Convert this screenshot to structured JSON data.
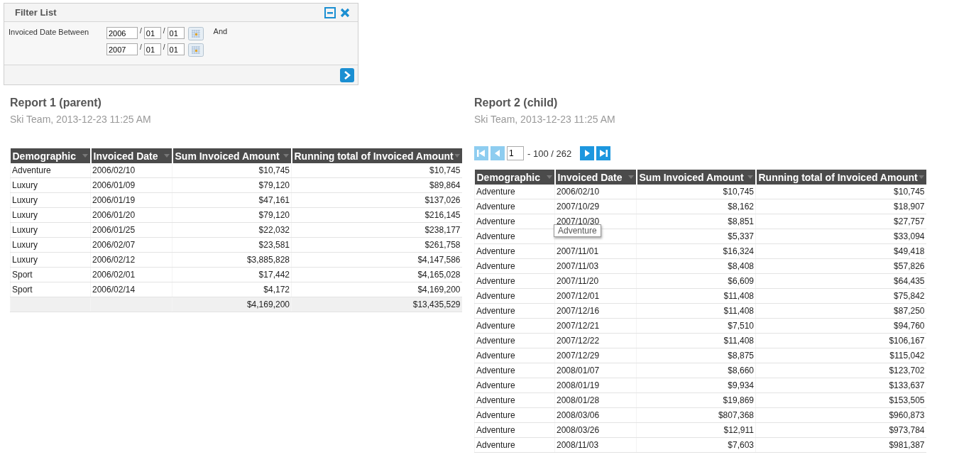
{
  "filter_panel": {
    "title": "Filter List",
    "label": "Invoiced Date Between",
    "dates": [
      {
        "year": "2006",
        "sep1": "/",
        "month": "01",
        "sep2": "/",
        "day": "01"
      },
      {
        "year": "2007",
        "sep1": "/",
        "month": "01",
        "sep2": "/",
        "day": "01"
      }
    ],
    "and_label": "And"
  },
  "reports": [
    {
      "title": "Report 1 (parent)",
      "subtitle": "Ski Team, 2013-12-23 11:25 AM",
      "columns": [
        "Demographic",
        "Invoiced Date",
        "Sum Invoiced Amount",
        "Running total of Invoiced Amount"
      ],
      "rows": [
        [
          "Adventure",
          "2006/02/10",
          "$10,745",
          "$10,745"
        ],
        [
          "Luxury",
          "2006/01/09",
          "$79,120",
          "$89,864"
        ],
        [
          "Luxury",
          "2006/01/19",
          "$47,161",
          "$137,026"
        ],
        [
          "Luxury",
          "2006/01/20",
          "$79,120",
          "$216,145"
        ],
        [
          "Luxury",
          "2006/01/25",
          "$22,032",
          "$238,177"
        ],
        [
          "Luxury",
          "2006/02/07",
          "$23,581",
          "$261,758"
        ],
        [
          "Luxury",
          "2006/02/12",
          "$3,885,828",
          "$4,147,586"
        ],
        [
          "Sport",
          "2006/02/01",
          "$17,442",
          "$4,165,028"
        ],
        [
          "Sport",
          "2006/02/14",
          "$4,172",
          "$4,169,200"
        ]
      ],
      "total_row": {
        "sum": "$4,169,200",
        "running_total": "$13,435,529"
      }
    },
    {
      "title": "Report 2 (child)",
      "subtitle": "Ski Team, 2013-12-23 11:25 AM",
      "pager": {
        "page": "1",
        "range": "- 100 / 262",
        "buttons": [
          {
            "kind": "first",
            "disabled": true
          },
          {
            "kind": "prev",
            "disabled": true
          },
          {
            "kind": "next",
            "disabled": false
          },
          {
            "kind": "last",
            "disabled": false
          }
        ]
      },
      "columns": [
        "Demographic",
        "Invoiced Date",
        "Sum Invoiced Amount",
        "Running total of Invoiced Amount"
      ],
      "rows": [
        [
          "Adventure",
          "2006/02/10",
          "$10,745",
          "$10,745"
        ],
        [
          "Adventure",
          "2007/10/29",
          "$8,162",
          "$18,907"
        ],
        [
          "Adventure",
          "2007/10/30",
          "$8,851",
          "$27,757"
        ],
        [
          "Adventure",
          null,
          "$5,337",
          "$33,094"
        ],
        [
          "Adventure",
          "2007/11/01",
          "$16,324",
          "$49,418"
        ],
        [
          "Adventure",
          "2007/11/03",
          "$8,408",
          "$57,826"
        ],
        [
          "Adventure",
          "2007/11/20",
          "$6,609",
          "$64,435"
        ],
        [
          "Adventure",
          "2007/12/01",
          "$11,408",
          "$75,842"
        ],
        [
          "Adventure",
          "2007/12/16",
          "$11,408",
          "$87,250"
        ],
        [
          "Adventure",
          "2007/12/21",
          "$7,510",
          "$94,760"
        ],
        [
          "Adventure",
          "2007/12/22",
          "$11,408",
          "$106,167"
        ],
        [
          "Adventure",
          "2007/12/29",
          "$8,875",
          "$115,042"
        ],
        [
          "Adventure",
          "2008/01/07",
          "$8,660",
          "$123,702"
        ],
        [
          "Adventure",
          "2008/01/19",
          "$9,934",
          "$133,637"
        ],
        [
          "Adventure",
          "2008/01/28",
          "$19,869",
          "$153,505"
        ],
        [
          "Adventure",
          "2008/03/06",
          "$807,368",
          "$960,873"
        ],
        [
          "Adventure",
          "2008/03/26",
          "$12,911",
          "$973,784"
        ],
        [
          "Adventure",
          "2008/11/03",
          "$7,603",
          "$981,387"
        ]
      ],
      "tooltip": {
        "text": "Adventure"
      }
    }
  ]
}
